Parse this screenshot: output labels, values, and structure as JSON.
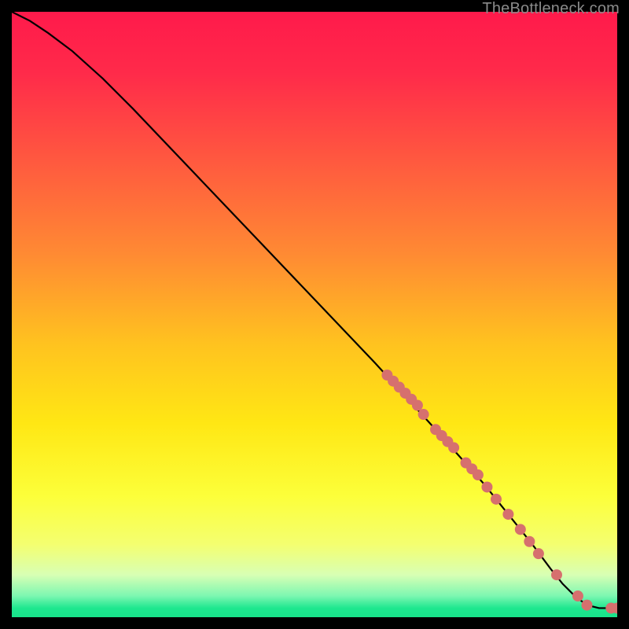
{
  "attribution": "TheBottleneck.com",
  "colors": {
    "gradient_stops": [
      {
        "offset": 0.0,
        "color": "#ff1a4b"
      },
      {
        "offset": 0.1,
        "color": "#ff2a4a"
      },
      {
        "offset": 0.25,
        "color": "#ff5a3f"
      },
      {
        "offset": 0.4,
        "color": "#ff8a33"
      },
      {
        "offset": 0.55,
        "color": "#ffc31f"
      },
      {
        "offset": 0.68,
        "color": "#ffe714"
      },
      {
        "offset": 0.8,
        "color": "#fcff3a"
      },
      {
        "offset": 0.88,
        "color": "#f4ff70"
      },
      {
        "offset": 0.93,
        "color": "#d8ffb4"
      },
      {
        "offset": 0.965,
        "color": "#7cf7b1"
      },
      {
        "offset": 0.985,
        "color": "#1ee78f"
      },
      {
        "offset": 1.0,
        "color": "#18e38a"
      }
    ],
    "line": "#000000",
    "marker": "#d6706e"
  },
  "chart_data": {
    "type": "line",
    "title": "",
    "xlabel": "",
    "ylabel": "",
    "xlim": [
      0,
      100
    ],
    "ylim": [
      0,
      100
    ],
    "series": [
      {
        "name": "curve",
        "x": [
          0,
          3,
          6,
          10,
          15,
          20,
          30,
          40,
          50,
          60,
          70,
          78,
          82,
          86,
          89,
          91,
          93,
          95,
          97,
          100
        ],
        "y": [
          100,
          98.5,
          96.5,
          93.5,
          89,
          84,
          73.5,
          63,
          52.5,
          42,
          31,
          22,
          17,
          12,
          8,
          5.5,
          3.5,
          2,
          1.5,
          1.5
        ]
      }
    ],
    "markers": {
      "name": "points",
      "series_ref": "curve",
      "x": [
        62,
        63,
        64,
        65,
        66,
        67,
        68,
        70,
        71,
        72,
        73,
        75,
        76,
        77,
        78.5,
        80,
        82,
        84,
        85.5,
        87,
        90,
        93.5,
        95,
        99,
        100
      ],
      "y": [
        40,
        39,
        38,
        37,
        36,
        35,
        33.5,
        31,
        30,
        29,
        28,
        25.5,
        24.5,
        23.5,
        21.5,
        19.5,
        17,
        14.5,
        12.5,
        10.5,
        7,
        3.5,
        2,
        1.5,
        1.5
      ]
    }
  }
}
